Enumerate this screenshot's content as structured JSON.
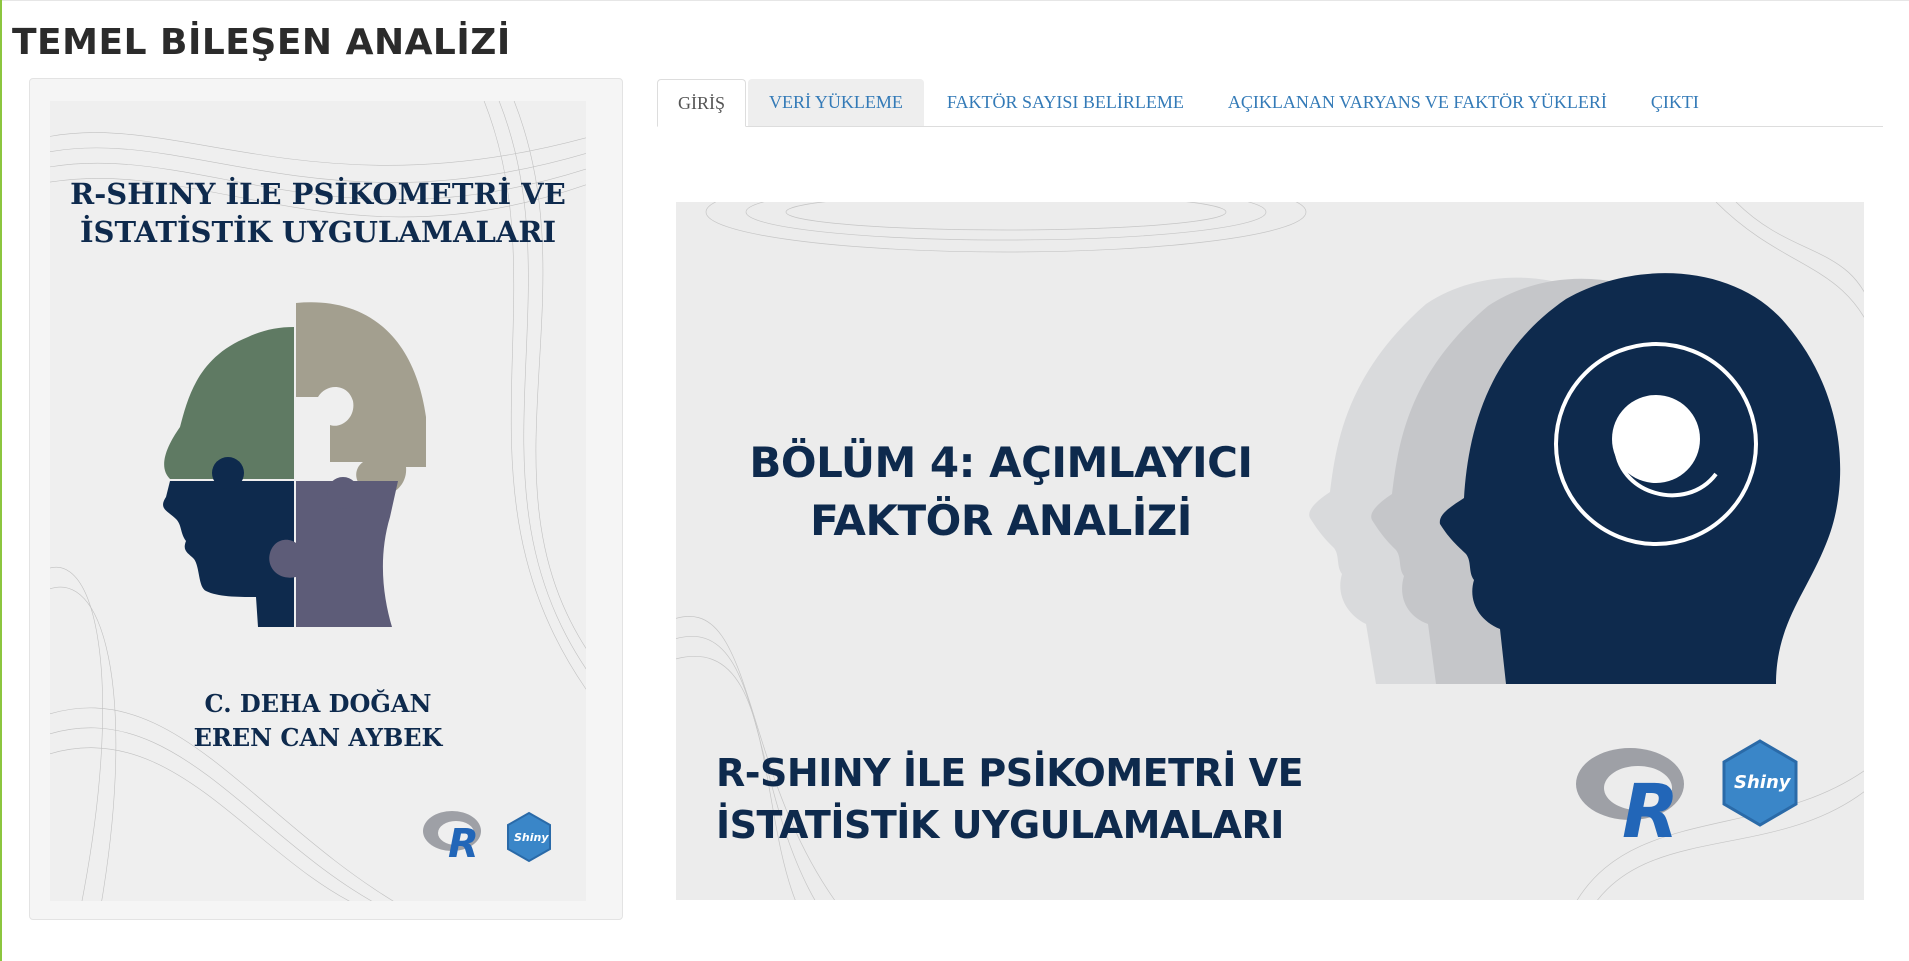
{
  "app": {
    "title": "TEMEL BİLEŞEN ANALİZİ"
  },
  "sidebar": {
    "cover": {
      "title": "R-SHINY İLE PSİKOMETRİ VE\nİSTATİSTİK UYGULAMALARI",
      "authors": "C. DEHA DOĞAN\nEREN CAN AYBEK",
      "r_logo_label": "R",
      "shiny_logo_label": "Shiny"
    }
  },
  "tabs": [
    {
      "label": "GİRİŞ",
      "active": true
    },
    {
      "label": "VERİ YÜKLEME",
      "active": false
    },
    {
      "label": "FAKTÖR SAYISI BELİRLEME",
      "active": false
    },
    {
      "label": "AÇIKLANAN VARYANS VE FAKTÖR YÜKLERİ",
      "active": false
    },
    {
      "label": "ÇIKTI",
      "active": false
    }
  ],
  "banner": {
    "chapter_title": "BÖLÜM 4: AÇIMLAYICI\nFAKTÖR ANALİZİ",
    "book_title": "R-SHINY İLE PSİKOMETRİ VE\nİSTATİSTİK UYGULAMALARI",
    "r_logo_label": "R",
    "shiny_logo_label": "Shiny"
  },
  "colors": {
    "navy": "#0e2a4d",
    "puzzle_green": "#5f7a63",
    "puzzle_taupe": "#a39f8f",
    "puzzle_purple": "#5d5c78",
    "tab_link": "#337ab7",
    "accent_green": "#8cc63f"
  }
}
